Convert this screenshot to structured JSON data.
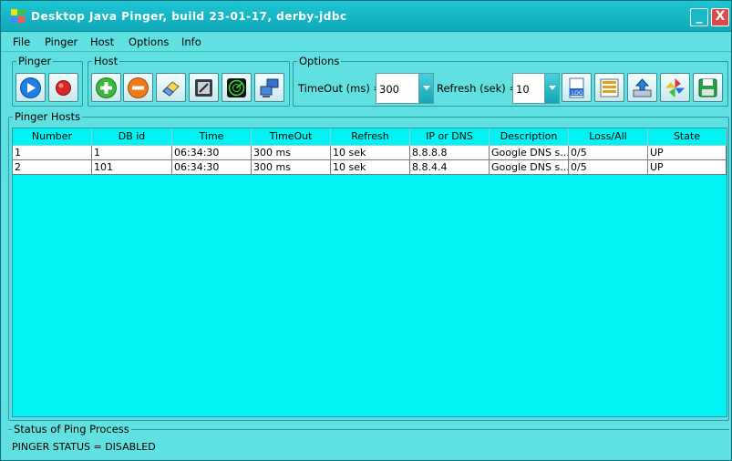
{
  "window": {
    "title": "Desktop Java Pinger, build 23-01-17, derby-jdbc",
    "minimize_label": "_",
    "close_label": "X"
  },
  "menu": [
    "File",
    "Pinger",
    "Host",
    "Options",
    "Info"
  ],
  "toolbar": {
    "pinger_group": "Pinger",
    "host_group": "Host",
    "options_group": "Options",
    "timeout_label": "TimeOut (ms) =",
    "timeout_value": "300",
    "refresh_label": "Refresh (sek) =",
    "refresh_value": "10"
  },
  "hosts": {
    "title": "Pinger Hosts",
    "columns": [
      "Number",
      "DB id",
      "Time",
      "TimeOut",
      "Refresh",
      "IP or DNS",
      "Description",
      "Loss/All",
      "State"
    ],
    "rows": [
      [
        "1",
        "1",
        "06:34:30",
        "300 ms",
        "10 sek",
        "8.8.8.8",
        "Google DNS s...",
        "0/5",
        "UP"
      ],
      [
        "2",
        "101",
        "06:34:30",
        "300 ms",
        "10 sek",
        "8.8.4.4",
        "Google DNS s...",
        "0/5",
        "UP"
      ]
    ]
  },
  "status": {
    "title": "Status of Ping Process",
    "text": "PINGER STATUS = DISABLED"
  },
  "colors": {
    "window_bg": "#60e0e0",
    "table_bg": "#00f2f2",
    "titlebar": "#15b7c6"
  }
}
